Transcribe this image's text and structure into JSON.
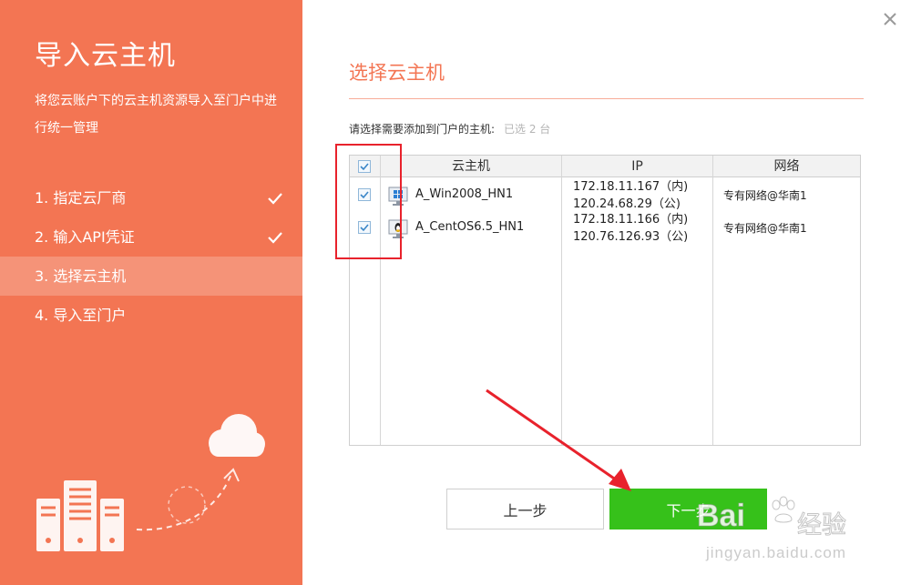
{
  "sidebar": {
    "title": "导入云主机",
    "description": "将您云账户下的云主机资源导入至门户中进行统一管理",
    "steps": [
      {
        "label": "1. 指定云厂商",
        "done": true
      },
      {
        "label": "2. 输入API凭证",
        "done": true
      },
      {
        "label": "3. 选择云主机",
        "done": false,
        "active": true
      },
      {
        "label": "4. 导入至门户",
        "done": false
      }
    ]
  },
  "main": {
    "heading": "选择云主机",
    "prompt": "请选择需要添加到门户的主机:",
    "selected_count": "已选 2 台",
    "table": {
      "headers": [
        "云主机",
        "IP",
        "网络"
      ],
      "rows": [
        {
          "name": "A_Win2008_HN1",
          "os_icon": "windows-icon",
          "ip_private": "172.18.11.167（内)",
          "ip_public": "120.24.68.29（公)",
          "network": "专有网络@华南1",
          "checked": true
        },
        {
          "name": "A_CentOS6.5_HN1",
          "os_icon": "linux-icon",
          "ip_private": "172.18.11.166（内)",
          "ip_public": "120.76.126.93（公)",
          "network": "专有网络@华南1",
          "checked": true
        }
      ]
    }
  },
  "buttons": {
    "prev": "上一步",
    "next": "下一步"
  },
  "watermark": {
    "brand": "Bai",
    "sub": "经验",
    "url": "jingyan.baidu.com"
  },
  "colors": {
    "accent": "#f37553",
    "next_button": "#36c11a",
    "annotation": "#e8222c"
  }
}
